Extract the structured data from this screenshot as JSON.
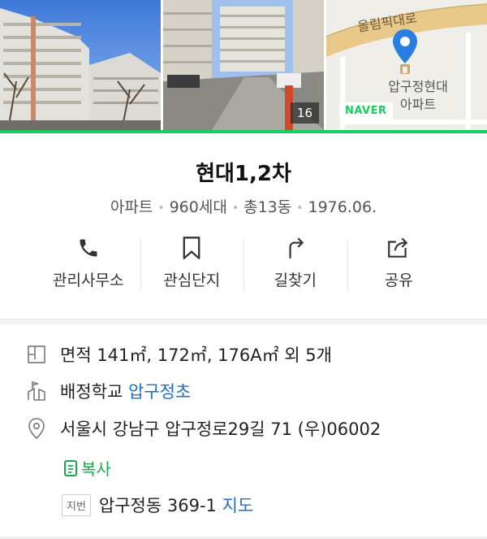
{
  "photos": {
    "count": "16"
  },
  "map": {
    "road_label": "올림픽대로",
    "place_label_line1": "압구정현대",
    "place_label_line2": "아파트",
    "brand": "NAVER"
  },
  "complex": {
    "name": "현대1,2차",
    "type": "아파트",
    "households": "960세대",
    "buildings": "총13동",
    "built": "1976.06."
  },
  "actions": [
    {
      "label": "관리사무소",
      "icon": "phone-icon"
    },
    {
      "label": "관심단지",
      "icon": "bookmark-icon"
    },
    {
      "label": "길찾기",
      "icon": "directions-icon"
    },
    {
      "label": "공유",
      "icon": "share-icon"
    }
  ],
  "info": {
    "area": "면적 141㎡, 172㎡, 176A㎡ 외 5개",
    "school_label": "배정학교",
    "school_link": "압구정초",
    "address": "서울시 강남구 압구정로29길 71 (우)06002",
    "copy_label": "복사",
    "jibun_tag": "지번",
    "jibun_address": "압구정동 369-1",
    "map_link": "지도"
  },
  "colors": {
    "brand_green": "#19ce60",
    "link_blue": "#1f6fc7",
    "copy_green": "#19a84a"
  }
}
